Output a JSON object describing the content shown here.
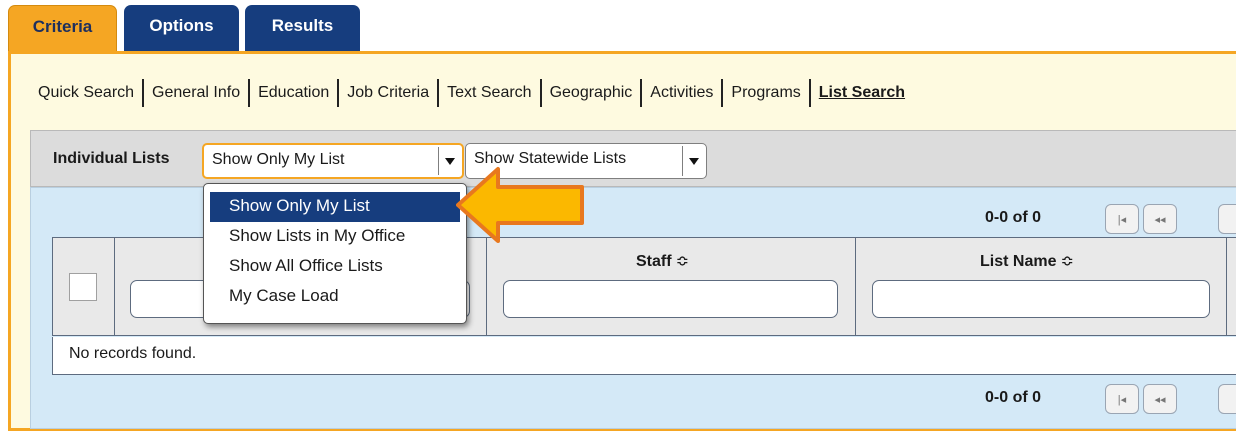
{
  "tabs": [
    {
      "label": "Criteria",
      "active": true
    },
    {
      "label": "Options",
      "active": false
    },
    {
      "label": "Results",
      "active": false
    }
  ],
  "subnav": {
    "items": [
      "Quick Search",
      "General Info",
      "Education",
      "Job Criteria",
      "Text Search",
      "Geographic",
      "Activities",
      "Programs",
      "List Search"
    ],
    "active": "List Search"
  },
  "filter": {
    "label": "Individual Lists",
    "select1_value": "Show Only My List",
    "select2_value": "Show Statewide Lists"
  },
  "dropdown": {
    "options": [
      "Show Only My List",
      "Show Lists in My Office",
      "Show All Office Lists",
      "My Case Load"
    ],
    "selected": "Show Only My List"
  },
  "pager": {
    "top_count": "0-0 of 0",
    "bottom_count": "0-0 of 0",
    "first_icon": "first-page-icon",
    "prev_icon": "previous-page-icon"
  },
  "table": {
    "columns": [
      {
        "label": "Staff",
        "sort": "⇕"
      },
      {
        "label": "List Name",
        "sort": "⇕"
      }
    ],
    "sort_symbol": "≎",
    "empty_message": "No records found."
  },
  "colors": {
    "accent_orange": "#f5a623",
    "tab_navy": "#163d7e",
    "panel_bg": "#fefae0",
    "results_bg": "#d4e9f7"
  }
}
